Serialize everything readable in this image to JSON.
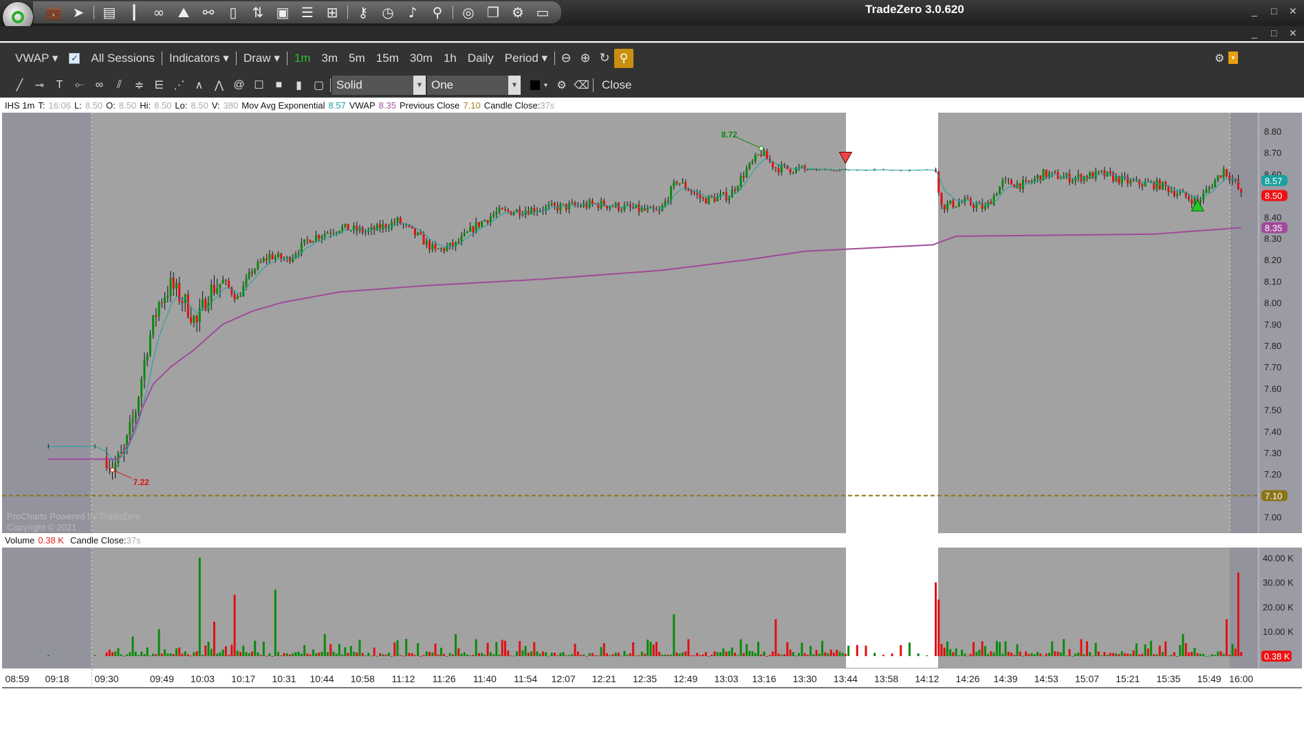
{
  "app": {
    "title": "TradeZero 3.0.620",
    "toolbar_icons": [
      "briefcase-icon",
      "send-order-icon",
      "level2-grid-icon",
      "candlestick-chart-icon",
      "binoculars-icon",
      "line-chart-icon",
      "link-icon",
      "document-icon",
      "up-down-arrows-icon",
      "layout-icon",
      "news-list-icon",
      "scanner-icon",
      "key-icon",
      "clock-icon",
      "alert-bell-icon",
      "search-icon",
      "globe-icon",
      "windows-icon",
      "settings-gear-icon",
      "monitor-icon"
    ],
    "window_controls": [
      "_",
      "□",
      "✕"
    ]
  },
  "toolbar1": {
    "indicator": "VWAP",
    "sessions": "All Sessions",
    "indicators": "Indicators",
    "draw": "Draw",
    "timeframes": [
      "1m",
      "3m",
      "5m",
      "15m",
      "30m",
      "1h",
      "Daily"
    ],
    "active_timeframe": "1m",
    "period": "Period"
  },
  "toolbar2": {
    "line_style": "Solid",
    "extend": "One",
    "close": "Close"
  },
  "info": {
    "symbol": "IHS 1m",
    "t_label": "T:",
    "t": "16:06",
    "l_label": "L:",
    "l": "8.50",
    "o_label": "O:",
    "o": "8.50",
    "hi_label": "Hi:",
    "hi": "8.50",
    "lo_label": "Lo:",
    "lo": "8.50",
    "v_label": "V:",
    "v": "380",
    "ema_label": "Mov Avg Exponential",
    "ema": "8.57",
    "vwap_label": "VWAP",
    "vwap": "8.35",
    "prev_label": "Previous Close",
    "prev": "7.10",
    "cc_label": "Candle Close:",
    "cc": "37s"
  },
  "volume_header": {
    "label": "Volume",
    "value": "0.38 K",
    "cc_label": "Candle Close:",
    "cc": "37s"
  },
  "watermark": [
    "ProCharts Powered by TradeZero",
    "Copyright © 2021"
  ],
  "colors": {
    "up": "#0a8a0a",
    "down": "#e01010",
    "ema": "#1aa0a0",
    "vwap": "#a04a9a",
    "prev_close": "#8a7418"
  },
  "chart_data": {
    "type": "candlestick",
    "symbol": "IHS",
    "interval": "1m",
    "y_ticks": [
      "8.80",
      "8.70",
      "8.60",
      "8.40",
      "8.30",
      "8.20",
      "8.10",
      "8.00",
      "7.90",
      "7.80",
      "7.70",
      "7.60",
      "7.50",
      "7.40",
      "7.30",
      "7.20",
      "7.00"
    ],
    "ylim": [
      7.0,
      8.8
    ],
    "price_tags": [
      {
        "label": "8.57",
        "value": 8.57,
        "color": "#1aa0a0"
      },
      {
        "label": "8.50",
        "value": 8.5,
        "color": "#ee1111"
      },
      {
        "label": "8.35",
        "value": 8.35,
        "color": "#a04a9a"
      },
      {
        "label": "7.10",
        "value": 7.1,
        "color": "#8a7418"
      }
    ],
    "annotations": {
      "high": {
        "label": "8.72",
        "minute": 225,
        "value": 8.72
      },
      "low": {
        "label": "7.22",
        "minute": 2,
        "value": 7.22
      }
    },
    "markers": [
      {
        "type": "sell",
        "minute": 254,
        "value": 8.67
      },
      {
        "type": "buy",
        "minute": 375,
        "value": 8.46
      }
    ],
    "price_path": [
      [
        0,
        7.28
      ],
      [
        2,
        7.23
      ],
      [
        6,
        7.3
      ],
      [
        10,
        7.5
      ],
      [
        14,
        7.8
      ],
      [
        18,
        8.0
      ],
      [
        22,
        8.08
      ],
      [
        27,
        8.0
      ],
      [
        31,
        7.9
      ],
      [
        35,
        8.05
      ],
      [
        40,
        8.1
      ],
      [
        45,
        8.02
      ],
      [
        50,
        8.15
      ],
      [
        56,
        8.22
      ],
      [
        62,
        8.2
      ],
      [
        70,
        8.3
      ],
      [
        80,
        8.35
      ],
      [
        90,
        8.33
      ],
      [
        100,
        8.38
      ],
      [
        108,
        8.3
      ],
      [
        113,
        8.24
      ],
      [
        120,
        8.27
      ],
      [
        127,
        8.36
      ],
      [
        134,
        8.42
      ],
      [
        150,
        8.44
      ],
      [
        170,
        8.46
      ],
      [
        190,
        8.42
      ],
      [
        196,
        8.57
      ],
      [
        205,
        8.48
      ],
      [
        214,
        8.5
      ],
      [
        220,
        8.62
      ],
      [
        225,
        8.7
      ],
      [
        230,
        8.63
      ],
      [
        240,
        8.62
      ],
      [
        285,
        8.62
      ],
      [
        287,
        8.45
      ],
      [
        295,
        8.47
      ],
      [
        302,
        8.44
      ],
      [
        308,
        8.56
      ],
      [
        316,
        8.55
      ],
      [
        322,
        8.6
      ],
      [
        332,
        8.58
      ],
      [
        342,
        8.6
      ],
      [
        352,
        8.56
      ],
      [
        362,
        8.55
      ],
      [
        370,
        8.5
      ],
      [
        375,
        8.47
      ],
      [
        384,
        8.62
      ],
      [
        388,
        8.56
      ],
      [
        390,
        8.5
      ]
    ],
    "vwap_path": [
      [
        -20,
        7.27
      ],
      [
        4,
        7.27
      ],
      [
        8,
        7.35
      ],
      [
        12,
        7.5
      ],
      [
        16,
        7.62
      ],
      [
        22,
        7.7
      ],
      [
        30,
        7.78
      ],
      [
        40,
        7.9
      ],
      [
        50,
        7.96
      ],
      [
        60,
        8.0
      ],
      [
        80,
        8.05
      ],
      [
        110,
        8.08
      ],
      [
        150,
        8.11
      ],
      [
        190,
        8.15
      ],
      [
        220,
        8.2
      ],
      [
        240,
        8.24
      ],
      [
        284,
        8.27
      ],
      [
        292,
        8.31
      ],
      [
        360,
        8.32
      ],
      [
        390,
        8.35
      ]
    ],
    "volume_ticks": [
      "40.00 K",
      "30.00 K",
      "20.00 K",
      "10.00 K"
    ],
    "volume_tag": "0.38 K",
    "volume_spikes_k": [
      [
        9,
        8
      ],
      [
        18,
        11
      ],
      [
        32,
        40
      ],
      [
        37,
        14
      ],
      [
        44,
        25
      ],
      [
        58,
        27
      ],
      [
        75,
        9
      ],
      [
        120,
        9
      ],
      [
        195,
        17
      ],
      [
        230,
        15
      ],
      [
        283,
        20
      ],
      [
        285,
        30
      ],
      [
        286,
        23
      ],
      [
        385,
        15
      ],
      [
        389,
        34
      ],
      [
        370,
        9
      ]
    ],
    "premarket_labels": [
      "08:59",
      "09:18"
    ],
    "x_labels": [
      "09:30",
      "09:49",
      "10:03",
      "10:17",
      "10:31",
      "10:44",
      "10:58",
      "11:12",
      "11:26",
      "11:40",
      "11:54",
      "12:07",
      "12:21",
      "12:35",
      "12:49",
      "13:03",
      "13:16",
      "13:30",
      "13:44",
      "13:58",
      "14:12",
      "14:26",
      "14:39",
      "14:53",
      "15:07",
      "15:21",
      "15:35",
      "15:49",
      "16:00"
    ]
  }
}
